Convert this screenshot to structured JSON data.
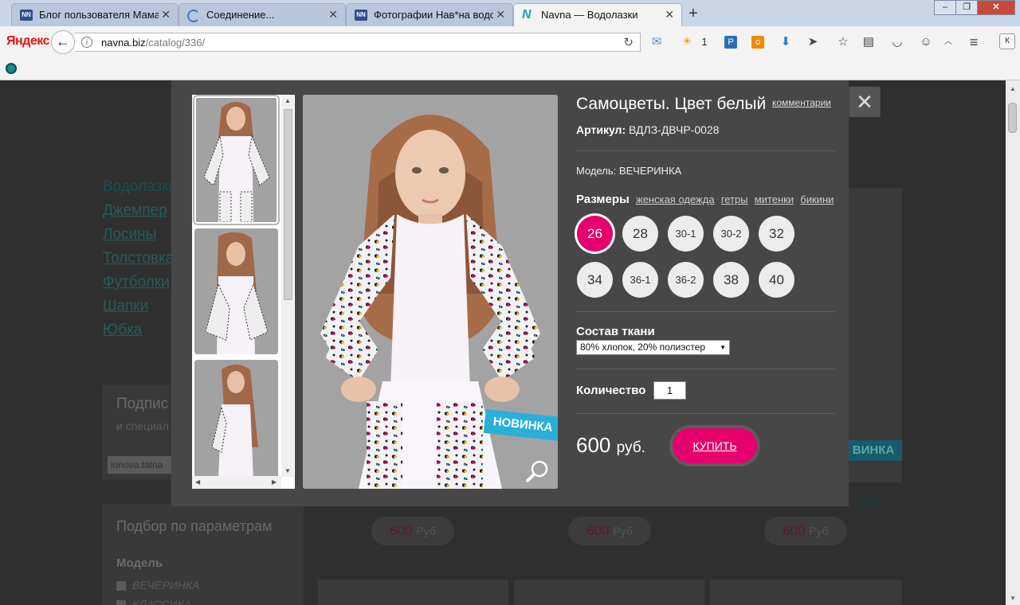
{
  "browser": {
    "tabs": [
      {
        "title": "Блог пользователя Мама ...",
        "favicon": "nn-icon"
      },
      {
        "title": "Соединение...",
        "favicon": "loading-spinner-icon"
      },
      {
        "title": "Фотографии Нав*на водо...",
        "favicon": "nn-icon"
      },
      {
        "title": "Navna — Водолазки",
        "favicon": "navna-icon",
        "active": true
      }
    ],
    "yandex_logo": "Яндекс",
    "url_domain": "navna.biz",
    "url_path": "/catalog/336/",
    "weather_count": "1",
    "k_button": "К"
  },
  "page": {
    "categories": [
      "Водолазки",
      "Джемпер",
      "Лосины",
      "Толстовка",
      "Футболки",
      "Шапки",
      "Юбка"
    ],
    "subscribe": {
      "title": "Подпис",
      "text": "и специал",
      "email_value": "ionova.tatna"
    },
    "filter": {
      "title": "Подбор по параметрам",
      "model_label": "Модель",
      "options": [
        "ВЕЧЕРИНКА",
        "КЛАССИКА"
      ]
    },
    "prices": [
      {
        "amount": "600",
        "currency": "Руб"
      },
      {
        "amount": "600",
        "currency": "Руб"
      },
      {
        "amount": "600",
        "currency": "Руб"
      }
    ],
    "bg_link": "елый",
    "bg_badge": "ВИНКА"
  },
  "modal": {
    "close": "✕",
    "product_title": "Самоцветы. Цвет белый",
    "comments_link": "комментарии",
    "article_label": "Артикул:",
    "article_value": "ВДЛЗ-ДВЧР-0028",
    "model_label": "Модель:",
    "model_value": "ВЕЧЕРИНКА",
    "sizes_label": "Размеры",
    "size_links": [
      "женская одежда",
      "гетры",
      "митенки",
      "бикини"
    ],
    "sizes": [
      "26",
      "28",
      "30-1",
      "30-2",
      "32",
      "34",
      "36-1",
      "36-2",
      "38",
      "40"
    ],
    "selected_size": "26",
    "fabric_label": "Состав ткани",
    "fabric_value": "80% хлопок, 20% полиэстер",
    "quantity_label": "Количество",
    "quantity_value": "1",
    "price_amount": "600",
    "price_currency": "руб.",
    "buy_button": "КУПИТЬ",
    "new_badge": "НОВИНКА",
    "accent_color": "#e5006d",
    "badge_color": "#2ab0d8"
  }
}
